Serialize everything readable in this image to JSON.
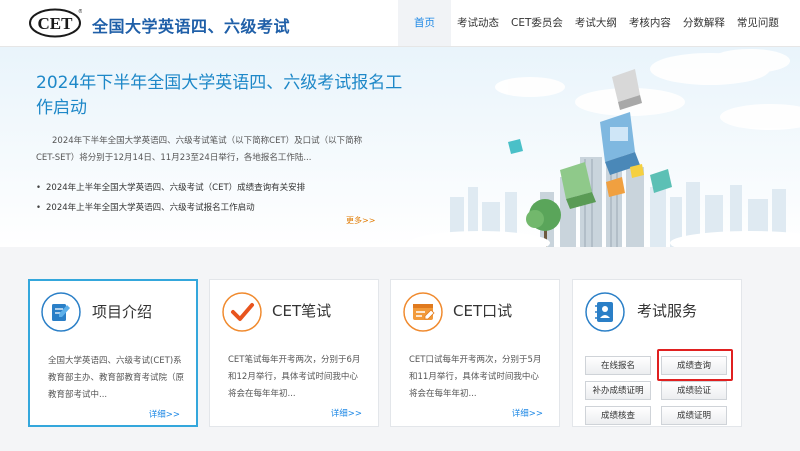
{
  "header": {
    "logo_text": "CET",
    "site_title": "全国大学英语四、六级考试",
    "nav": [
      "首页",
      "考试动态",
      "CET委员会",
      "考试大纲",
      "考核内容",
      "分数解释",
      "常见问题"
    ]
  },
  "banner": {
    "title": "2024年下半年全国大学英语四、六级考试报名工作启动",
    "description": "2024年下半年全国大学英语四、六级考试笔试（以下简称CET）及口试（以下简称CET-SET）将分别于12月14日、11月23至24日举行，各地报名工作陆...",
    "news": [
      "2024年上半年全国大学英语四、六级考试（CET）成绩查询有关安排",
      "2024年上半年全国大学英语四、六级考试报名工作启动"
    ],
    "more": "更多>>"
  },
  "cards": [
    {
      "title": "项目介绍",
      "desc": "全国大学英语四、六级考试(CET)系教育部主办、教育部教育考试院（原教育部考试中...",
      "more": "详细>>"
    },
    {
      "title": "CET笔试",
      "desc": "CET笔试每年开考两次，分别于6月和12月举行，具体考试时间我中心将会在每年年初...",
      "more": "详细>>"
    },
    {
      "title": "CET口试",
      "desc": "CET口试每年开考两次，分别于5月和11月举行，具体考试时间我中心将会在每年年初...",
      "more": "详细>>"
    },
    {
      "title": "考试服务"
    }
  ],
  "services": [
    "在线报名",
    "成绩查询",
    "补办成绩证明",
    "成绩验证",
    "成绩核查",
    "成绩证明"
  ],
  "colors": {
    "brand": "#1f5fa8",
    "accent": "#1e88e5",
    "highlight": "#e02020",
    "card_selected": "#34a7dc",
    "icon_orange": "#f08a2e",
    "icon_blue": "#2a7fc7"
  }
}
